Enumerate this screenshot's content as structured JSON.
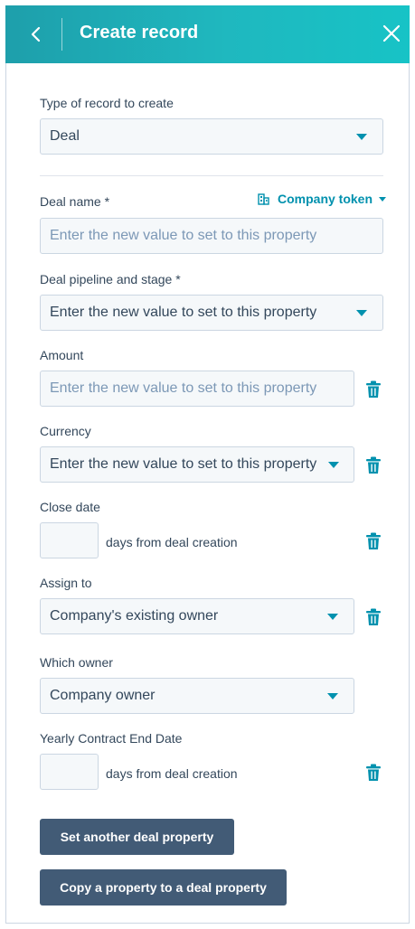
{
  "header": {
    "title": "Create record",
    "back_icon": "chevron-left-icon",
    "close_icon": "close-icon"
  },
  "record_type": {
    "label": "Type of record to create",
    "value": "Deal"
  },
  "deal_name": {
    "label": "Deal name *",
    "placeholder": "Enter the new value to set to this property",
    "token_label": "Company token"
  },
  "pipeline": {
    "label": "Deal pipeline and stage *",
    "value": "Enter the new value to set to this property"
  },
  "amount": {
    "label": "Amount",
    "placeholder": "Enter the new value to set to this property"
  },
  "currency": {
    "label": "Currency",
    "value": "Enter the new value to set to this property"
  },
  "close_date": {
    "label": "Close date",
    "suffix": "days from deal creation"
  },
  "assign_to": {
    "label": "Assign to",
    "value": "Company's existing owner"
  },
  "which_owner": {
    "label": "Which owner",
    "value": "Company owner"
  },
  "contract_end": {
    "label": "Yearly Contract End Date",
    "suffix": "days from deal creation"
  },
  "buttons": {
    "set_another": "Set another deal property",
    "copy_property": "Copy a property to a deal property"
  },
  "colors": {
    "header_start": "#1e9fab",
    "header_end": "#17c3c6",
    "accent": "#0091ae",
    "button_bg": "#425b76",
    "field_bg": "#f5f8fa",
    "border": "#cbd6e2"
  }
}
